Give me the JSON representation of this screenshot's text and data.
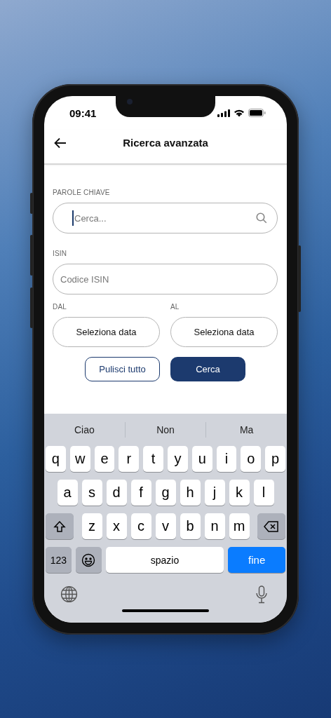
{
  "status_bar": {
    "time": "09:41"
  },
  "header": {
    "title": "Ricerca avanzata"
  },
  "form": {
    "keywords": {
      "label": "PAROLE CHIAVE",
      "placeholder": "Cerca...",
      "focused": true
    },
    "isin": {
      "label": "ISIN",
      "placeholder": "Codice ISIN",
      "focused": false
    },
    "dates": [
      {
        "label": "DAL",
        "button": "Seleziona data"
      },
      {
        "label": "AL",
        "button": "Seleziona data"
      }
    ],
    "actions": [
      {
        "label": "Pulisci tutto",
        "kind": "secondary"
      },
      {
        "label": "Cerca",
        "kind": "primary"
      }
    ]
  },
  "keyboard": {
    "suggestions": [
      "Ciao",
      "Non",
      "Ma"
    ],
    "rows": [
      [
        "q",
        "w",
        "e",
        "r",
        "t",
        "y",
        "u",
        "i",
        "o",
        "p"
      ],
      [
        "a",
        "s",
        "d",
        "f",
        "g",
        "h",
        "j",
        "k",
        "l"
      ],
      [
        "z",
        "x",
        "c",
        "v",
        "b",
        "n",
        "m"
      ]
    ],
    "numbers_key": "123",
    "space_key": "spazio",
    "return_key": "fine"
  }
}
